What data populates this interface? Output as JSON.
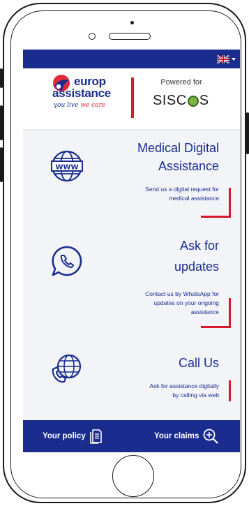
{
  "language": {
    "selected": "UK flag"
  },
  "brand": {
    "logo_line1": "europ",
    "logo_line2": "assistance",
    "tagline_prefix": "you live ",
    "tagline_highlight": "we care",
    "powered_label": "Powered for",
    "partner_name_left": "SISC",
    "partner_name_right": "S"
  },
  "services": [
    {
      "title_line1": "Medical Digital",
      "title_line2": "Assistance",
      "desc_line1": "Send us a digital request for",
      "desc_line2": "medical assistance",
      "desc_line3": "",
      "icon": "www-globe-icon"
    },
    {
      "title_line1": "Ask for",
      "title_line2": "updates",
      "desc_line1": "Contact us by WhatsApp for",
      "desc_line2": "updates on your ongoing",
      "desc_line3": "assistance",
      "icon": "whatsapp-icon"
    },
    {
      "title_line1": "Call Us",
      "title_line2": "",
      "desc_line1": "Ask for assistance digitally",
      "desc_line2": "by calling via web",
      "desc_line3": "",
      "icon": "globe-phone-icon"
    }
  ],
  "bottom_nav": {
    "policy_label": "Your policy",
    "claims_label": "Your claims"
  },
  "colors": {
    "primary": "#1a2d8f",
    "accent": "#d8182b",
    "background": "#f3f4f8"
  }
}
